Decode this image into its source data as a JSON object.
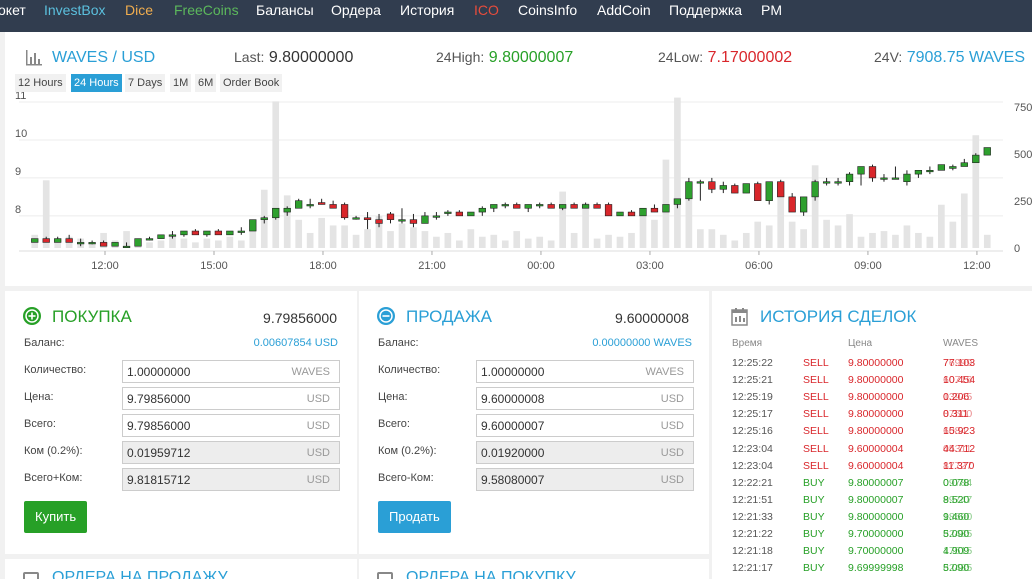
{
  "nav": {
    "items": [
      {
        "label": "окет",
        "color": "#ffffff"
      },
      {
        "label": "InvestBox",
        "color": "#5bc0de"
      },
      {
        "label": "Dice",
        "color": "#f0ad4e"
      },
      {
        "label": "FreeCoins",
        "color": "#5cb85c"
      },
      {
        "label": "Балансы",
        "color": "#ffffff"
      },
      {
        "label": "Ордера",
        "color": "#ffffff"
      },
      {
        "label": "История",
        "color": "#ffffff"
      },
      {
        "label": "ICO",
        "color": "#e74c3c"
      },
      {
        "label": "CoinsInfo",
        "color": "#ffffff"
      },
      {
        "label": "AddCoin",
        "color": "#ffffff"
      },
      {
        "label": "Поддержка",
        "color": "#ffffff"
      },
      {
        "label": "PM",
        "color": "#ffffff"
      }
    ]
  },
  "market": {
    "base": "WAVES",
    "sep": " / ",
    "quote": "USD",
    "last_label": "Last:",
    "last": "9.80000000",
    "high_label": "24High:",
    "high": "9.80000007",
    "low_label": "24Low:",
    "low": "7.17000002",
    "vol_label": "24V:",
    "vol": "7908.75 WAVES"
  },
  "timeframes": [
    {
      "label": "12 Hours",
      "active": false
    },
    {
      "label": "24 Hours",
      "active": true
    },
    {
      "label": "7 Days",
      "active": false
    },
    {
      "label": "1M",
      "active": false
    },
    {
      "label": "6M",
      "active": false
    },
    {
      "label": "Order Book",
      "active": false
    }
  ],
  "colors": {
    "up": "#2ea02e",
    "down": "#d9262b",
    "volume": "#e4e4e4",
    "accent": "#2a9fd6",
    "buy": "#27a027",
    "sell": "#d9262b"
  },
  "chart_data": {
    "type": "candlestick",
    "x_ticks": [
      "12:00",
      "15:00",
      "18:00",
      "21:00",
      "00:00",
      "03:00",
      "06:00",
      "09:00",
      "12:00"
    ],
    "y_ticks": [
      "11",
      "10",
      "9",
      "8"
    ],
    "y2_ticks": [
      "750",
      "500",
      "250",
      "0"
    ],
    "ylim": [
      7.1,
      11
    ],
    "y2lim": [
      0,
      750
    ],
    "candles": [
      [
        7.3,
        7.4,
        7.3,
        7.4,
        70
      ],
      [
        7.4,
        7.45,
        7.3,
        7.3,
        360
      ],
      [
        7.3,
        7.45,
        7.3,
        7.4,
        40
      ],
      [
        7.4,
        7.5,
        7.3,
        7.3,
        60
      ],
      [
        7.3,
        7.4,
        7.2,
        7.3,
        50
      ],
      [
        7.3,
        7.35,
        7.25,
        7.3,
        20
      ],
      [
        7.3,
        7.35,
        7.2,
        7.2,
        80
      ],
      [
        7.2,
        7.3,
        7.2,
        7.3,
        40
      ],
      [
        7.2,
        7.3,
        7.2,
        7.2,
        90
      ],
      [
        7.2,
        7.4,
        7.2,
        7.4,
        50
      ],
      [
        7.4,
        7.45,
        7.35,
        7.4,
        30
      ],
      [
        7.4,
        7.5,
        7.4,
        7.5,
        40
      ],
      [
        7.5,
        7.6,
        7.4,
        7.5,
        60
      ],
      [
        7.5,
        7.6,
        7.45,
        7.6,
        50
      ],
      [
        7.6,
        7.65,
        7.5,
        7.5,
        30
      ],
      [
        7.5,
        7.6,
        7.45,
        7.6,
        50
      ],
      [
        7.6,
        7.65,
        7.5,
        7.5,
        40
      ],
      [
        7.5,
        7.6,
        7.5,
        7.6,
        60
      ],
      [
        7.6,
        7.7,
        7.5,
        7.6,
        40
      ],
      [
        7.6,
        7.9,
        7.6,
        7.9,
        120
      ],
      [
        7.9,
        8.0,
        7.8,
        7.95,
        310
      ],
      [
        7.95,
        8.2,
        7.9,
        8.2,
        780
      ],
      [
        8.1,
        8.25,
        8.0,
        8.2,
        280
      ],
      [
        8.2,
        8.45,
        8.2,
        8.4,
        150
      ],
      [
        8.3,
        8.45,
        8.2,
        8.3,
        80
      ],
      [
        8.35,
        8.45,
        8.3,
        8.3,
        160
      ],
      [
        8.3,
        8.4,
        8.2,
        8.2,
        120
      ],
      [
        8.3,
        8.35,
        7.9,
        7.95,
        120
      ],
      [
        7.95,
        8.0,
        7.9,
        7.95,
        70
      ],
      [
        7.95,
        8.1,
        7.65,
        7.9,
        100
      ],
      [
        7.9,
        8.05,
        7.7,
        7.8,
        170
      ],
      [
        8.05,
        8.1,
        7.8,
        7.9,
        90
      ],
      [
        7.9,
        8.2,
        7.8,
        7.9,
        130
      ],
      [
        7.9,
        8.05,
        7.7,
        7.8,
        110
      ],
      [
        7.8,
        8.1,
        7.8,
        8.0,
        90
      ],
      [
        8.0,
        8.1,
        7.9,
        8.0,
        60
      ],
      [
        8.1,
        8.15,
        8.0,
        8.1,
        80
      ],
      [
        8.1,
        8.15,
        8.0,
        8.0,
        40
      ],
      [
        8.0,
        8.1,
        8.0,
        8.1,
        100
      ],
      [
        8.1,
        8.25,
        8.0,
        8.2,
        60
      ],
      [
        8.2,
        8.3,
        8.1,
        8.3,
        70
      ],
      [
        8.3,
        8.35,
        8.2,
        8.3,
        40
      ],
      [
        8.3,
        8.35,
        8.2,
        8.2,
        90
      ],
      [
        8.2,
        8.3,
        8.1,
        8.3,
        50
      ],
      [
        8.3,
        8.35,
        8.2,
        8.3,
        60
      ],
      [
        8.3,
        8.35,
        8.2,
        8.2,
        40
      ],
      [
        8.2,
        8.3,
        8.15,
        8.3,
        300
      ],
      [
        8.3,
        8.35,
        8.2,
        8.2,
        80
      ],
      [
        8.2,
        8.35,
        8.2,
        8.3,
        240
      ],
      [
        8.3,
        8.35,
        8.2,
        8.2,
        50
      ],
      [
        8.3,
        8.35,
        8.0,
        8.0,
        70
      ],
      [
        8.0,
        8.1,
        8.0,
        8.1,
        60
      ],
      [
        8.1,
        8.15,
        8.0,
        8.0,
        80
      ],
      [
        8.0,
        8.2,
        8.0,
        8.2,
        180
      ],
      [
        8.2,
        8.3,
        8.1,
        8.1,
        150
      ],
      [
        8.1,
        8.3,
        8.1,
        8.3,
        470
      ],
      [
        8.3,
        8.45,
        8.2,
        8.45,
        800
      ],
      [
        8.45,
        9.0,
        8.4,
        8.9,
        330
      ],
      [
        8.9,
        8.95,
        8.4,
        8.9,
        100
      ],
      [
        8.9,
        9.0,
        8.6,
        8.7,
        100
      ],
      [
        8.7,
        8.9,
        8.6,
        8.8,
        70
      ],
      [
        8.8,
        8.85,
        8.6,
        8.6,
        40
      ],
      [
        8.6,
        8.85,
        8.6,
        8.85,
        80
      ],
      [
        8.85,
        8.9,
        8.4,
        8.4,
        140
      ],
      [
        8.4,
        8.9,
        8.3,
        8.9,
        120
      ],
      [
        8.9,
        8.95,
        8.5,
        8.5,
        290
      ],
      [
        8.5,
        8.6,
        8.1,
        8.1,
        140
      ],
      [
        8.1,
        8.5,
        8.0,
        8.5,
        100
      ],
      [
        8.5,
        8.95,
        8.4,
        8.9,
        440
      ],
      [
        8.9,
        9.0,
        8.8,
        8.9,
        150
      ],
      [
        8.9,
        9.0,
        8.8,
        8.9,
        120
      ],
      [
        8.9,
        9.15,
        8.8,
        9.1,
        180
      ],
      [
        9.1,
        9.3,
        8.8,
        9.3,
        60
      ],
      [
        9.3,
        9.35,
        8.9,
        9.0,
        80
      ],
      [
        9.0,
        9.1,
        8.9,
        9.0,
        90
      ],
      [
        9.0,
        9.3,
        9.0,
        9.0,
        70
      ],
      [
        8.9,
        9.2,
        8.8,
        9.1,
        120
      ],
      [
        9.1,
        9.2,
        9.0,
        9.2,
        80
      ],
      [
        9.2,
        9.3,
        9.1,
        9.2,
        60
      ],
      [
        9.2,
        9.35,
        9.2,
        9.35,
        230
      ],
      [
        9.25,
        9.35,
        9.2,
        9.3,
        140
      ],
      [
        9.3,
        9.5,
        9.3,
        9.4,
        290
      ],
      [
        9.4,
        9.65,
        9.4,
        9.6,
        600
      ],
      [
        9.6,
        9.8,
        9.6,
        9.8,
        70
      ]
    ]
  },
  "buy": {
    "title": "ПОКУПКА",
    "price": "9.79856000",
    "balance_label": "Баланс:",
    "balance": "0.00607854 USD",
    "fields": [
      {
        "label": "Количество:",
        "value": "1.00000000",
        "unit": "WAVES"
      },
      {
        "label": "Цена:",
        "value": "9.79856000",
        "unit": "USD"
      },
      {
        "label": "Всего:",
        "value": "9.79856000",
        "unit": "USD"
      },
      {
        "label": "Ком (0.2%):",
        "value": "0.01959712",
        "unit": "USD"
      },
      {
        "label": "Всего+Ком:",
        "value": "9.81815712",
        "unit": "USD"
      }
    ],
    "button": "Купить"
  },
  "sell": {
    "title": "ПРОДАЖА",
    "price": "9.60000008",
    "balance_label": "Баланс:",
    "balance": "0.00000000 WAVES",
    "fields": [
      {
        "label": "Количество:",
        "value": "1.00000000",
        "unit": "WAVES"
      },
      {
        "label": "Цена:",
        "value": "9.60000008",
        "unit": "USD"
      },
      {
        "label": "Всего:",
        "value": "9.60000007",
        "unit": "USD"
      },
      {
        "label": "Ком (0.2%):",
        "value": "0.01920000",
        "unit": "USD"
      },
      {
        "label": "Всего-Ком:",
        "value": "9.58080007",
        "unit": "USD"
      }
    ],
    "button": "Продать"
  },
  "history": {
    "title": "ИСТОРИЯ СДЕЛОК",
    "columns": [
      "Время",
      "Цена",
      "WAVES"
    ],
    "rows": [
      {
        "time": "12:25:22",
        "type": "SELL",
        "price": "9.80000000",
        "amt_a": "77.103",
        "amt_b": "76999"
      },
      {
        "time": "12:25:21",
        "type": "SELL",
        "price": "9.80000000",
        "amt_a": "10.454",
        "amt_b": "60716"
      },
      {
        "time": "12:25:19",
        "type": "SELL",
        "price": "9.80000000",
        "amt_a": "0.206",
        "amt_b": "13945"
      },
      {
        "time": "12:25:17",
        "type": "SELL",
        "price": "9.80000000",
        "amt_a": "0.311",
        "amt_b": "87500"
      },
      {
        "time": "12:25:16",
        "type": "SELL",
        "price": "9.80000000",
        "amt_a": "15.923",
        "amt_b": "6084"
      },
      {
        "time": "12:23:04",
        "type": "SELL",
        "price": "9.60000004",
        "amt_a": "44.712",
        "amt_b": "05311"
      },
      {
        "time": "12:23:04",
        "type": "SELL",
        "price": "9.60000004",
        "amt_a": "11.370",
        "amt_b": "87727"
      },
      {
        "time": "12:22:21",
        "type": "BUY",
        "price": "9.80000007",
        "amt_a": "0.078",
        "amt_b": "09784"
      },
      {
        "time": "12:21:51",
        "type": "BUY",
        "price": "9.80000007",
        "amt_a": "8.520",
        "amt_b": "99747"
      },
      {
        "time": "12:21:33",
        "type": "BUY",
        "price": "9.80000000",
        "amt_a": "9.460",
        "amt_b": "18600"
      },
      {
        "time": "12:21:22",
        "type": "BUY",
        "price": "9.70000000",
        "amt_a": "5.090",
        "amt_b": "82485"
      },
      {
        "time": "12:21:18",
        "type": "BUY",
        "price": "9.70000000",
        "amt_a": "4.909",
        "amt_b": "17515"
      },
      {
        "time": "12:21:17",
        "type": "BUY",
        "price": "9.69999998",
        "amt_a": "5.090",
        "amt_b": "82485"
      }
    ]
  },
  "lower": {
    "sell_orders": "ОРДЕРА НА ПРОДАЖУ",
    "buy_orders": "ОРДЕРА НА ПОКУПКУ"
  }
}
